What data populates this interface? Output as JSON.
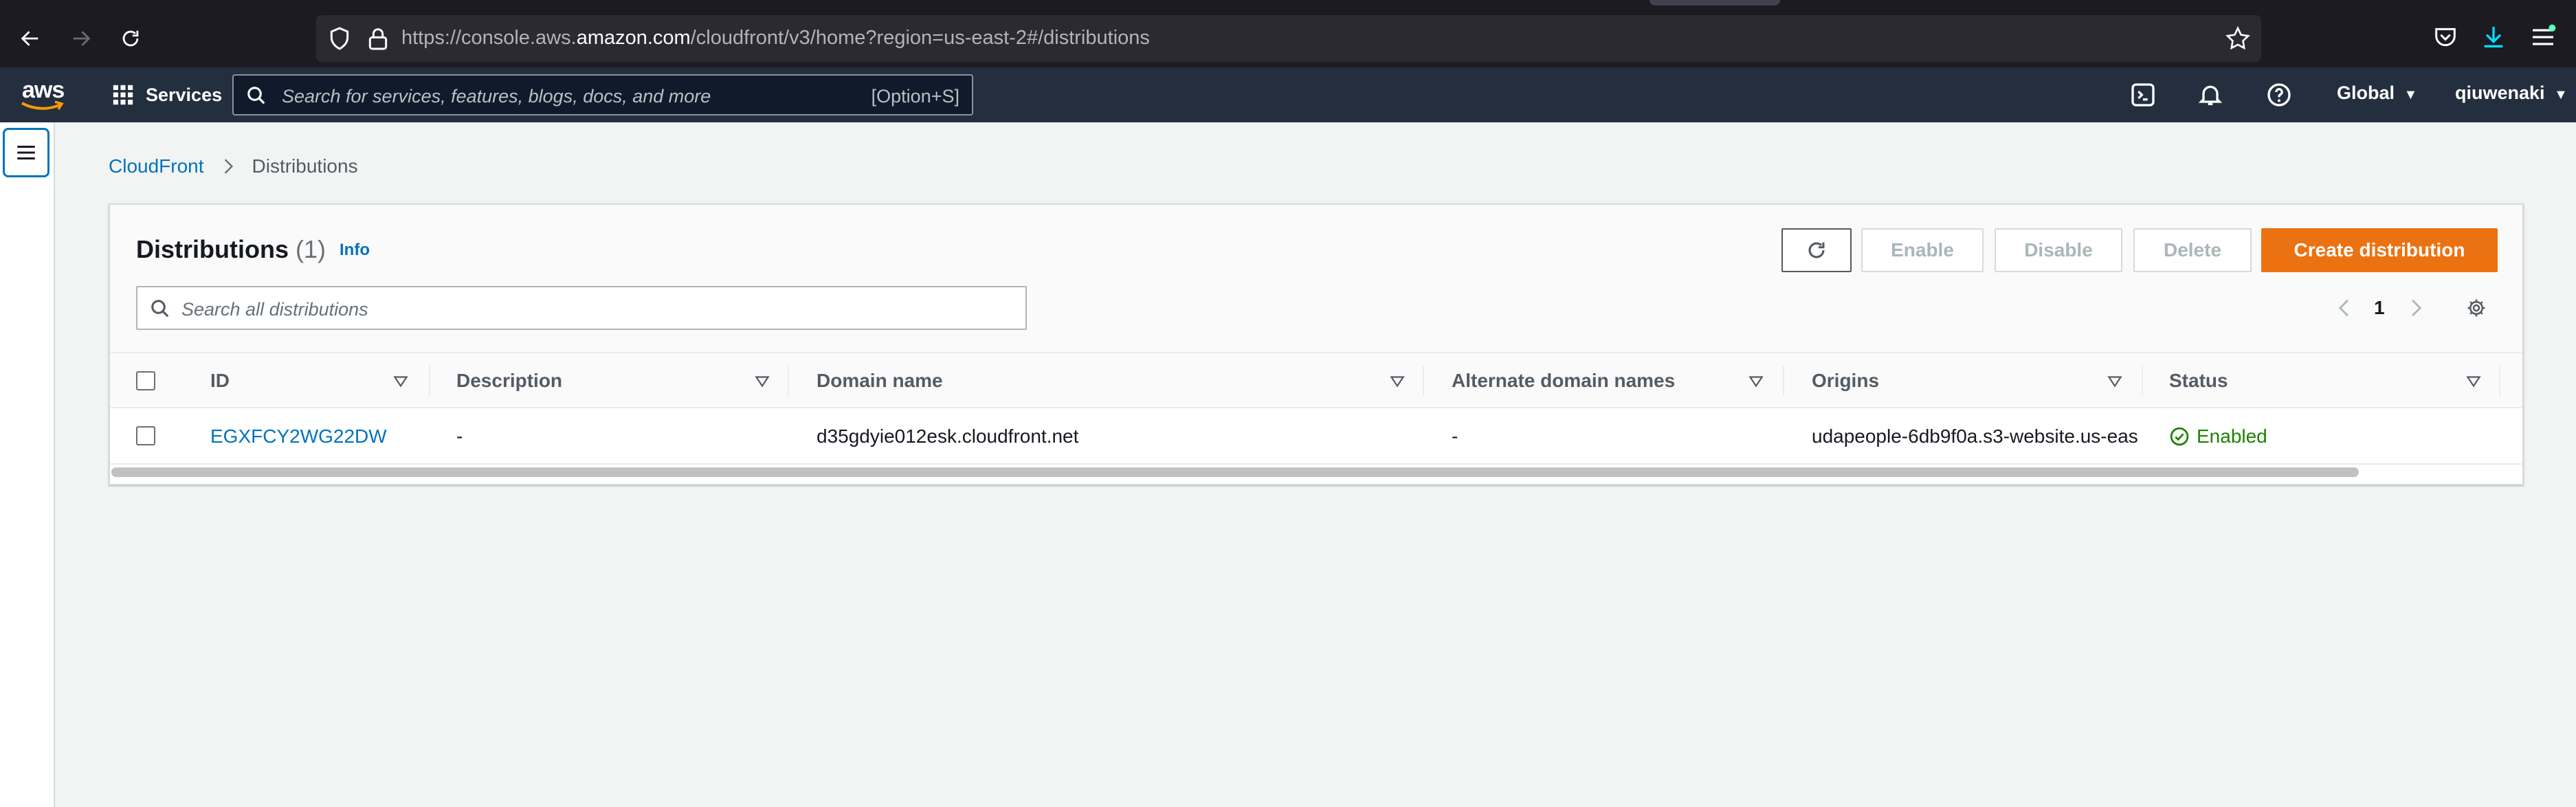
{
  "browser": {
    "url_prefix": "https://console.aws.",
    "url_host": "amazon.com",
    "url_path": "/cloudfront/v3/home?region=us-east-2#/distributions"
  },
  "aws_nav": {
    "logo_text": "aws",
    "services_label": "Services",
    "search_placeholder": "Search for services, features, blogs, docs, and more",
    "search_shortcut": "[Option+S]",
    "region_label": "Global",
    "user_label": "qiuwenaki"
  },
  "breadcrumb": {
    "root": "CloudFront",
    "current": "Distributions"
  },
  "panel": {
    "title": "Distributions",
    "count": "(1)",
    "info_label": "Info",
    "buttons": {
      "enable": "Enable",
      "disable": "Disable",
      "delete": "Delete",
      "create": "Create distribution"
    },
    "search_placeholder": "Search all distributions",
    "page_number": "1"
  },
  "table": {
    "columns": [
      "ID",
      "Description",
      "Domain name",
      "Alternate domain names",
      "Origins",
      "Status"
    ],
    "rows": [
      {
        "id": "EGXFCY2WG22DW",
        "description": "-",
        "domain_name": "d35gdyie012esk.cloudfront.net",
        "alternate_domain_names": "-",
        "origins": "udapeople-6db9f0a.s3-website.us-eas",
        "status": "Enabled"
      }
    ]
  },
  "colors": {
    "aws_nav_bg": "#232f3e",
    "primary_button": "#ec7211",
    "link": "#0073bb",
    "status_enabled": "#1d8102"
  }
}
